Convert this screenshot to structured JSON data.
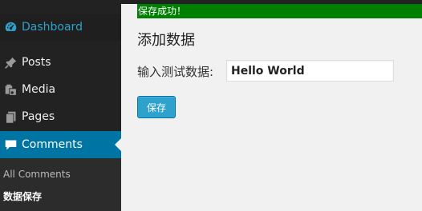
{
  "sidebar": {
    "items": [
      {
        "label": "Dashboard",
        "icon": "dashboard-icon"
      },
      {
        "label": "Posts",
        "icon": "pin-icon"
      },
      {
        "label": "Media",
        "icon": "media-icon"
      },
      {
        "label": "Pages",
        "icon": "pages-icon"
      },
      {
        "label": "Comments",
        "icon": "comment-icon"
      }
    ],
    "submenu": [
      {
        "label": "All Comments"
      },
      {
        "label": "数据保存"
      }
    ]
  },
  "notice": {
    "text": "保存成功！"
  },
  "main": {
    "title": "添加数据",
    "field_label": "输入测试数据:",
    "field_value": "Hello World",
    "save_label": "保存"
  },
  "colors": {
    "sidebar_bg": "#222222",
    "active_bg": "#0074a2",
    "dashboard_text": "#2ea2cc",
    "notice_bg": "#008000",
    "button_bg": "#2ea2cc"
  }
}
